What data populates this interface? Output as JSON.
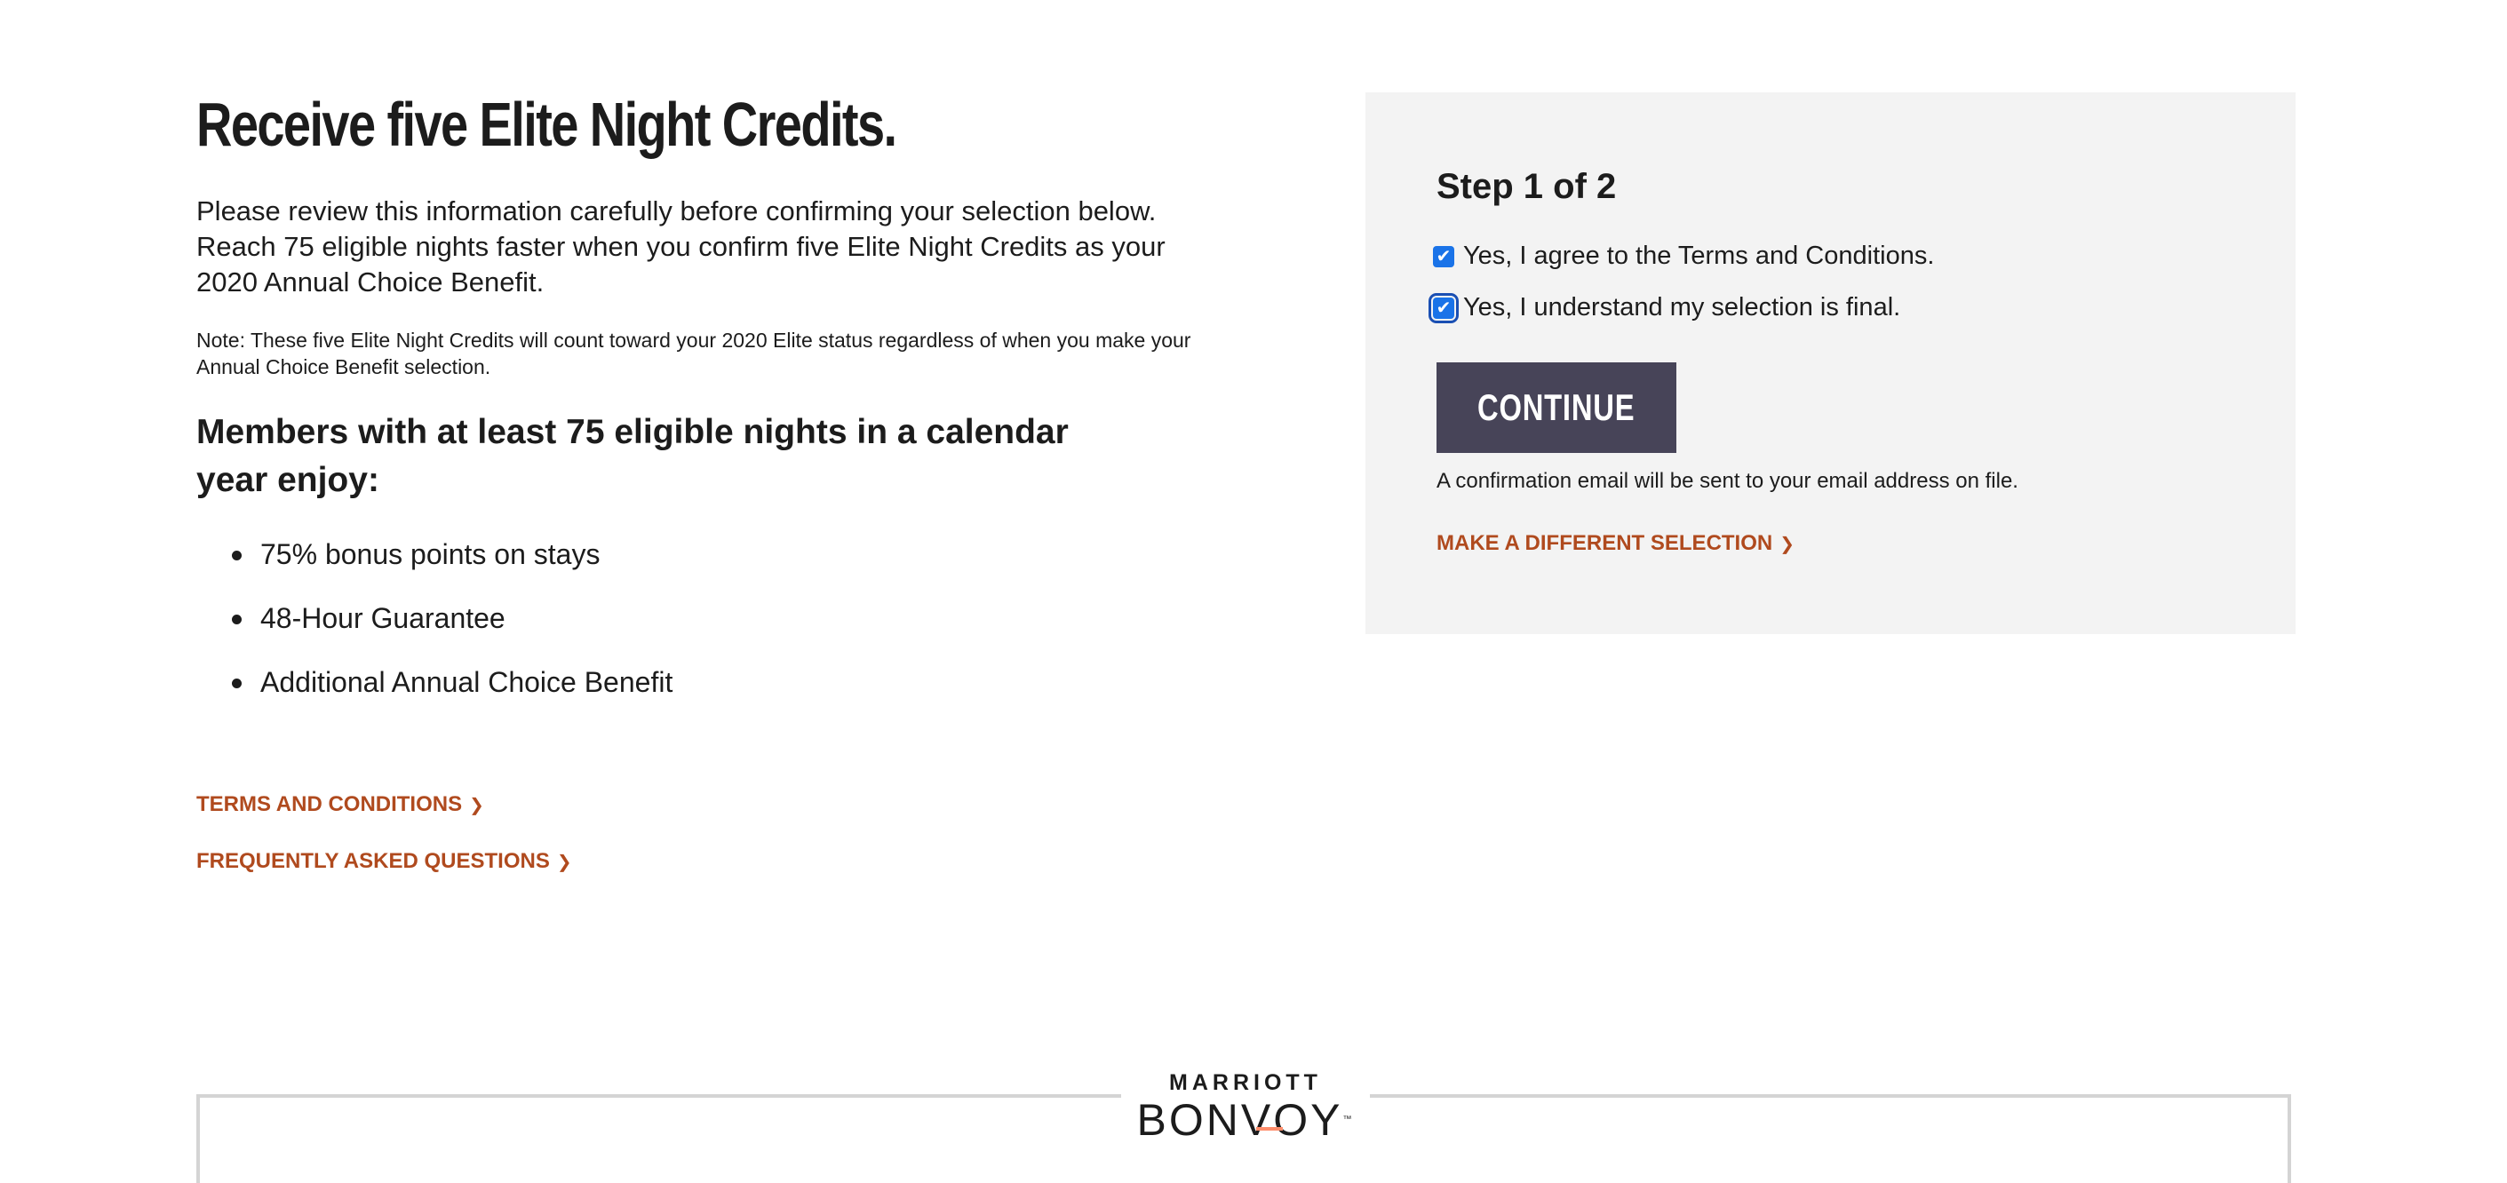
{
  "main": {
    "headline": "Receive five Elite Night Credits.",
    "intro": "Please review this information carefully before confirming your selection below. Reach 75 eligible nights faster when you confirm five Elite Night Credits as your 2020 Annual Choice Benefit.",
    "note": "Note: These five Elite Night Credits will count toward your 2020 Elite status regardless of when you make your Annual Choice Benefit selection.",
    "members_heading": "Members with at least 75 eligible nights in a calendar year enjoy:",
    "benefits": [
      "75% bonus points on stays",
      "48-Hour Guarantee",
      "Additional Annual Choice Benefit"
    ],
    "links": {
      "terms": "TERMS AND CONDITIONS",
      "faq": "FREQUENTLY ASKED QUESTIONS"
    }
  },
  "panel": {
    "step": "Step 1 of 2",
    "checkbox_terms": "Yes, I agree to the Terms and Conditions.",
    "checkbox_final": "Yes, I understand my selection is final.",
    "checkbox_terms_checked": true,
    "checkbox_final_checked": true,
    "continue_label": "CONTINUE",
    "confirmation_note": "A confirmation email will be sent to your email address on file.",
    "different_selection": "MAKE A DIFFERENT SELECTION"
  },
  "footer": {
    "logo_top": "MARRIOTT",
    "logo_main": "BONVOY",
    "logo_tm": "™"
  },
  "colors": {
    "link": "#b04a1e",
    "button": "#474458",
    "panel_bg": "#f3f3f3",
    "checkbox": "#1a73e8",
    "logo_accent": "#ff8d6b"
  },
  "icons": {
    "chevron": "chevron-right-icon",
    "check": "checkmark-icon"
  }
}
